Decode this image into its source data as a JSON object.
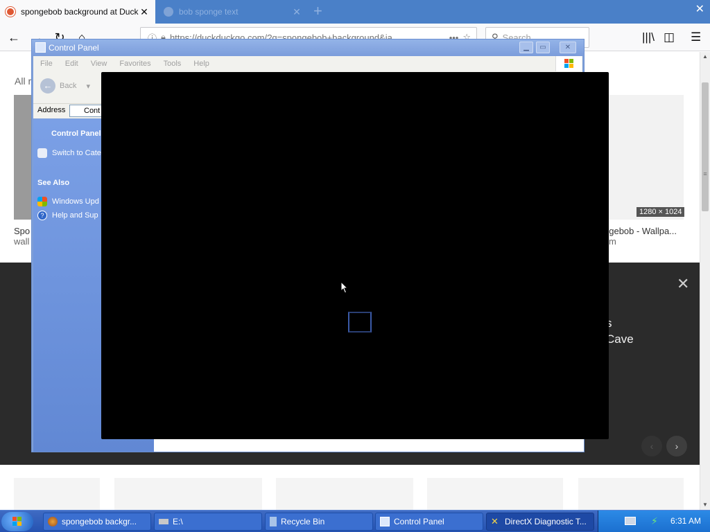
{
  "browser": {
    "tabs": [
      {
        "label": "spongebob background at Duck",
        "active": true
      },
      {
        "label": "bob sponge text",
        "active": false
      }
    ],
    "url": "https://duckduckgo.com/?q=spongebob+background&ia",
    "search_placeholder": "Search",
    "icons": [
      "back-icon",
      "forward-icon",
      "reload-icon",
      "home-icon",
      "info-icon",
      "lock-icon",
      "page-actions-icon",
      "bookmark-star-icon",
      "search-icon",
      "library-icon",
      "sidebar-icon",
      "menu-icon"
    ]
  },
  "page": {
    "all_results": "All r",
    "image_dims": "1280 × 1024",
    "caption_left_1": "Spo",
    "caption_left_2": "wall",
    "caption_right_1": "ngebob - Wallpa...",
    "caption_right_2": "m",
    "overlay_text_1": "s",
    "overlay_text_2": "Cave"
  },
  "control_panel": {
    "title": "Control Panel",
    "menu": [
      "File",
      "Edit",
      "View",
      "Favorites",
      "Tools",
      "Help"
    ],
    "back_label": "Back",
    "address_label": "Address",
    "address_value": "Cont",
    "sidebar_header": "Control Panel",
    "switch_category": "Switch to Cate",
    "see_also": "See Also",
    "windows_update": "Windows Upd",
    "help_support": "Help and Sup"
  },
  "taskbar": {
    "items": [
      {
        "label": "spongebob backgr...",
        "active": false
      },
      {
        "label": "E:\\",
        "active": false
      },
      {
        "label": "Recycle Bin",
        "active": false
      },
      {
        "label": "Control Panel",
        "active": false
      },
      {
        "label": "DirectX Diagnostic T...",
        "active": true
      }
    ],
    "clock": "6:31 AM"
  },
  "colors": {
    "tabbar": "#4a80c8",
    "xp_taskbar": "#2552b1",
    "cp_sidebar": "#7ba0e6",
    "dx_window": "#000000"
  }
}
